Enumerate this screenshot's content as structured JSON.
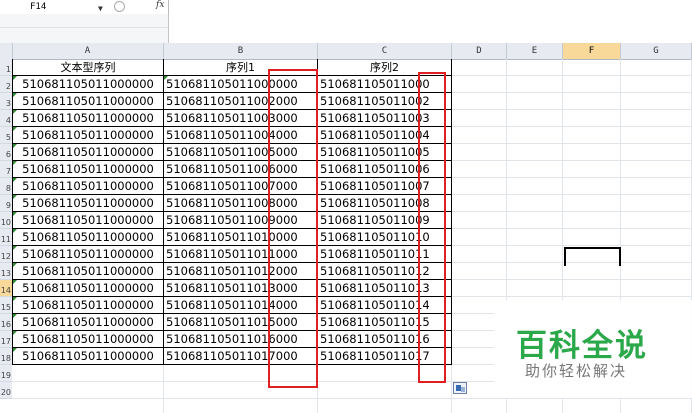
{
  "name_box": {
    "value": "F14",
    "dropdown_icon": "chevron-down-icon"
  },
  "formula_bar": {
    "fx_label": "fx",
    "value": ""
  },
  "columns": [
    "A",
    "B",
    "C",
    "D",
    "E",
    "F",
    "G"
  ],
  "active_column": "F",
  "rows": [
    "1",
    "2",
    "3",
    "4",
    "5",
    "6",
    "7",
    "8",
    "9",
    "10",
    "11",
    "12",
    "13",
    "14",
    "15",
    "16",
    "17",
    "18",
    "19",
    "20"
  ],
  "active_row": "14",
  "table": {
    "headers": [
      "文本型序列",
      "序列1",
      "序列2"
    ],
    "data": [
      [
        "510681105011000000",
        "510681105011000000",
        "510681105011000"
      ],
      [
        "510681105011000000",
        "510681105011002000",
        "510681105011002"
      ],
      [
        "510681105011000000",
        "510681105011003000",
        "510681105011003"
      ],
      [
        "510681105011000000",
        "510681105011004000",
        "510681105011004"
      ],
      [
        "510681105011000000",
        "510681105011005000",
        "510681105011005"
      ],
      [
        "510681105011000000",
        "510681105011006000",
        "510681105011006"
      ],
      [
        "510681105011000000",
        "510681105011007000",
        "510681105011007"
      ],
      [
        "510681105011000000",
        "510681105011008000",
        "510681105011008"
      ],
      [
        "510681105011000000",
        "510681105011009000",
        "510681105011009"
      ],
      [
        "510681105011000000",
        "510681105011010000",
        "510681105011010"
      ],
      [
        "510681105011000000",
        "510681105011011000",
        "510681105011011"
      ],
      [
        "510681105011000000",
        "510681105011012000",
        "510681105011012"
      ],
      [
        "510681105011000000",
        "510681105011013000",
        "510681105011013"
      ],
      [
        "510681105011000000",
        "510681105011014000",
        "510681105011014"
      ],
      [
        "510681105011000000",
        "510681105011015000",
        "510681105011015"
      ],
      [
        "510681105011000000",
        "510681105011016000",
        "510681105011016"
      ],
      [
        "510681105011000000",
        "510681105011017000",
        "510681105011017"
      ]
    ]
  },
  "watermark": {
    "title": "百科全说",
    "subtitle": "助你轻松解决"
  },
  "colors": {
    "highlight": "#e02020",
    "active_header": "#f9d99a",
    "watermark": "#2aa84a",
    "error_triangle": "#2e8b2e"
  }
}
